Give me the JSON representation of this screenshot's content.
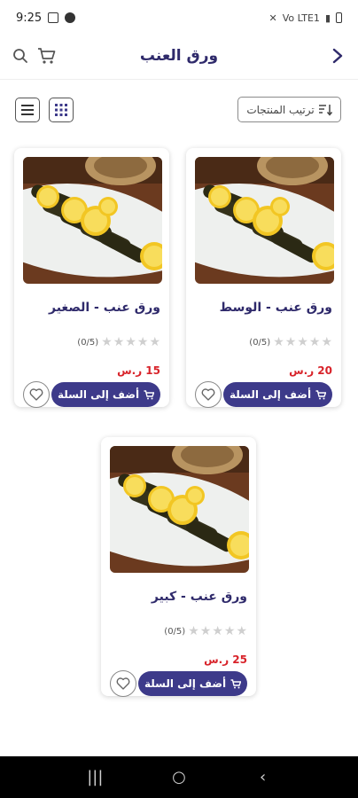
{
  "status": {
    "time": "9:25",
    "right_text": "Vo LTE1"
  },
  "header": {
    "title": "ورق العنب"
  },
  "toolbar": {
    "sort_label": "ترتيب المنتجات"
  },
  "products": [
    {
      "name": "ورق عنب - الوسط",
      "rating_text": "(0/5)",
      "price": "20 ر.س",
      "add_label": "أضف إلى السلة",
      "rating": 0
    },
    {
      "name": "ورق عنب - الصغير",
      "rating_text": "(0/5)",
      "price": "15 ر.س",
      "add_label": "أضف إلى السلة",
      "rating": 0
    },
    {
      "name": "ورق عنب - كبير",
      "rating_text": "(0/5)",
      "price": "25 ر.س",
      "add_label": "أضف إلى السلة",
      "rating": 0
    }
  ],
  "nav": {
    "recent": "|||",
    "home": "○",
    "back": "‹"
  },
  "colors": {
    "primary": "#3d3a8a",
    "title": "#2f2a6b",
    "price": "#d8232a"
  }
}
